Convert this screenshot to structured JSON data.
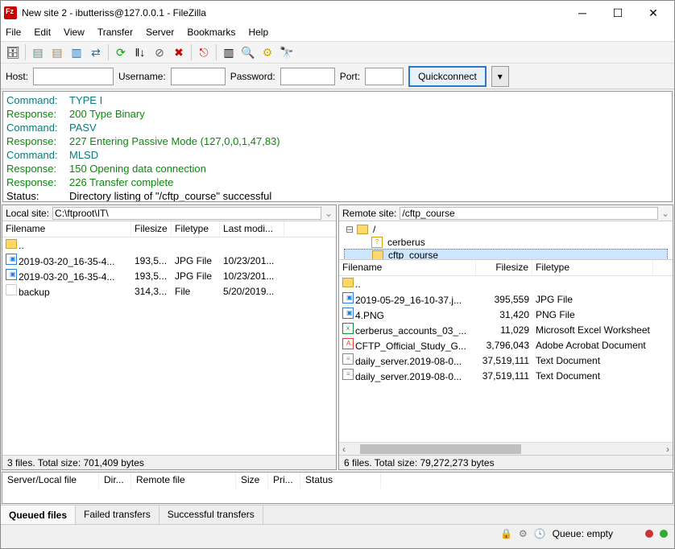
{
  "window": {
    "title": "New site 2 - ibutteriss@127.0.0.1 - FileZilla"
  },
  "menu": [
    "File",
    "Edit",
    "View",
    "Transfer",
    "Server",
    "Bookmarks",
    "Help"
  ],
  "quickbar": {
    "host_label": "Host:",
    "username_label": "Username:",
    "password_label": "Password:",
    "port_label": "Port:",
    "connect_label": "Quickconnect"
  },
  "log": [
    {
      "type": "Command:",
      "text": "TYPE I",
      "cls": "teal"
    },
    {
      "type": "Response:",
      "text": "200 Type Binary",
      "cls": "green"
    },
    {
      "type": "Command:",
      "text": "PASV",
      "cls": "teal"
    },
    {
      "type": "Response:",
      "text": "227 Entering Passive Mode (127,0,0,1,47,83)",
      "cls": "green"
    },
    {
      "type": "Command:",
      "text": "MLSD",
      "cls": "teal"
    },
    {
      "type": "Response:",
      "text": "150 Opening data connection",
      "cls": "green"
    },
    {
      "type": "Response:",
      "text": "226 Transfer complete",
      "cls": "green"
    },
    {
      "type": "Status:",
      "text": "Directory listing of \"/cftp_course\" successful",
      "cls": "black"
    }
  ],
  "local": {
    "site_label": "Local site:",
    "path": "C:\\ftproot\\IT\\",
    "headers": {
      "name": "Filename",
      "size": "Filesize",
      "type": "Filetype",
      "mod": "Last modi..."
    },
    "files": [
      {
        "name": "..",
        "size": "",
        "type": "",
        "mod": "",
        "icon": "folder"
      },
      {
        "name": "2019-03-20_16-35-4...",
        "size": "193,5...",
        "type": "JPG File",
        "mod": "10/23/201...",
        "icon": "jpg"
      },
      {
        "name": "2019-03-20_16-35-4...",
        "size": "193,5...",
        "type": "JPG File",
        "mod": "10/23/201...",
        "icon": "jpg"
      },
      {
        "name": "backup",
        "size": "314,3...",
        "type": "File",
        "mod": "5/20/2019...",
        "icon": "file"
      }
    ],
    "status": "3 files. Total size: 701,409 bytes"
  },
  "remote": {
    "site_label": "Remote site:",
    "path": "/cftp_course",
    "tree": [
      {
        "name": "/",
        "depth": 0,
        "exp": "minus",
        "icon": "folder"
      },
      {
        "name": "cerberus",
        "depth": 1,
        "exp": "",
        "icon": "unk"
      },
      {
        "name": "cftp_course",
        "depth": 1,
        "exp": "",
        "icon": "folder",
        "sel": true
      }
    ],
    "headers": {
      "name": "Filename",
      "size": "Filesize",
      "type": "Filetype"
    },
    "files": [
      {
        "name": "..",
        "size": "",
        "type": "",
        "icon": "folder"
      },
      {
        "name": "2019-05-29_16-10-37.j...",
        "size": "395,559",
        "type": "JPG File",
        "icon": "jpg"
      },
      {
        "name": "4.PNG",
        "size": "31,420",
        "type": "PNG File",
        "icon": "png"
      },
      {
        "name": "cerberus_accounts_03_...",
        "size": "11,029",
        "type": "Microsoft Excel Worksheet",
        "icon": "xls"
      },
      {
        "name": "CFTP_Official_Study_G...",
        "size": "3,796,043",
        "type": "Adobe Acrobat Document",
        "icon": "pdf"
      },
      {
        "name": "daily_server.2019-08-0...",
        "size": "37,519,111",
        "type": "Text Document",
        "icon": "txt"
      },
      {
        "name": "daily_server.2019-08-0...",
        "size": "37,519,111",
        "type": "Text Document",
        "icon": "txt"
      }
    ],
    "status": "6 files. Total size: 79,272,273 bytes"
  },
  "queue": {
    "headers": [
      "Server/Local file",
      "Dir...",
      "Remote file",
      "Size",
      "Pri...",
      "Status"
    ],
    "tabs": [
      "Queued files",
      "Failed transfers",
      "Successful transfers"
    ],
    "active_tab": 0
  },
  "statusbar": {
    "queue_label": "Queue: empty"
  }
}
